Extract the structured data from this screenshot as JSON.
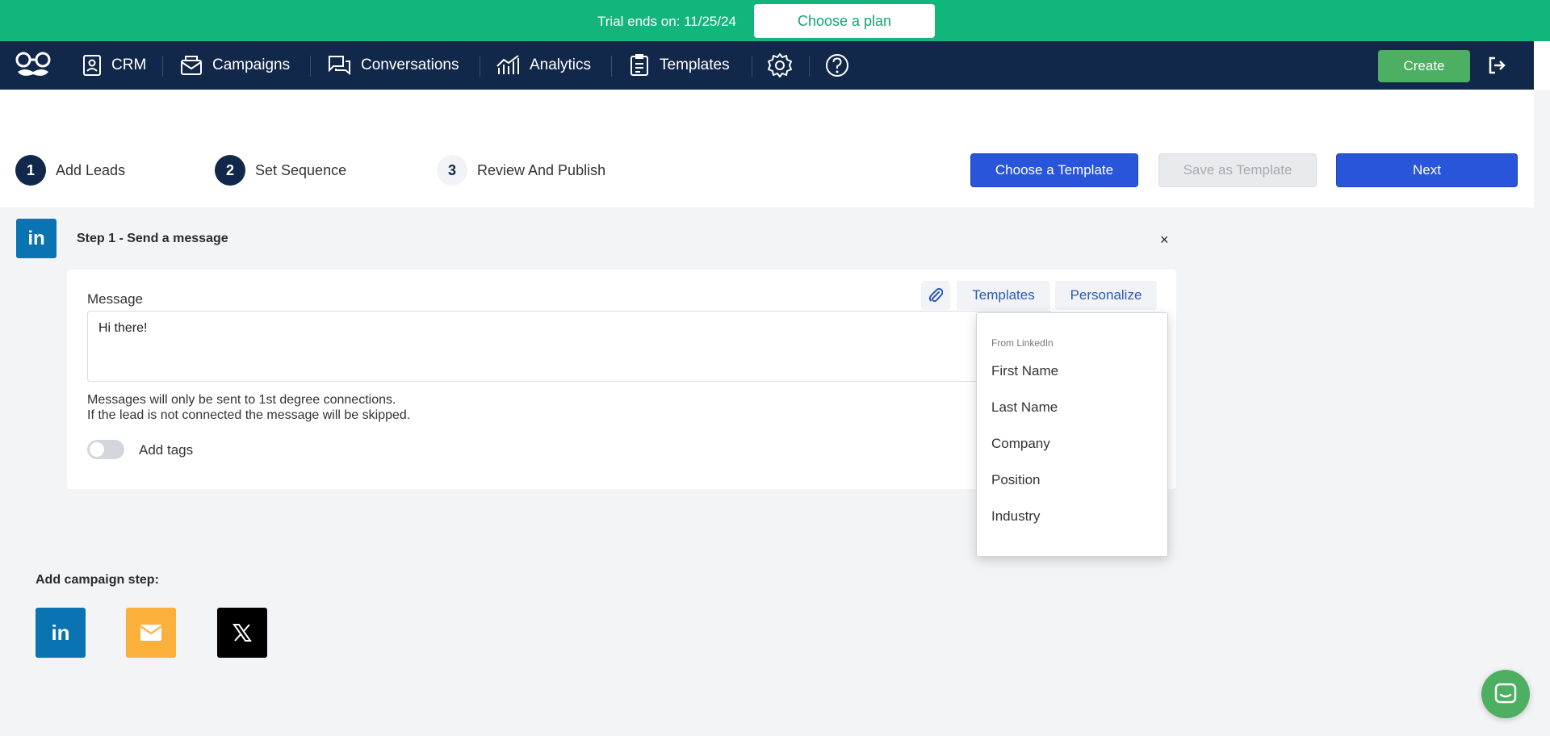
{
  "trial_banner": {
    "text": "Trial ends on: 11/25/24",
    "button_label": "Choose a plan"
  },
  "nav": {
    "items": [
      {
        "label": "CRM",
        "icon": "contact-card-icon"
      },
      {
        "label": "Campaigns",
        "icon": "envelope-icon"
      },
      {
        "label": "Conversations",
        "icon": "chat-bubbles-icon"
      },
      {
        "label": "Analytics",
        "icon": "bar-chart-icon"
      },
      {
        "label": "Templates",
        "icon": "document-icon"
      }
    ],
    "settings_icon": "gear-icon",
    "help_icon": "help-circle-icon",
    "create_label": "Create",
    "logout_icon": "logout-icon"
  },
  "stepper": {
    "steps": [
      {
        "number": "1",
        "label": "Add Leads"
      },
      {
        "number": "2",
        "label": "Set Sequence"
      },
      {
        "number": "3",
        "label": "Review And Publish"
      }
    ],
    "choose_template_label": "Choose a Template",
    "save_template_label": "Save as Template",
    "next_label": "Next"
  },
  "step_card": {
    "badge": "in",
    "title": "Step 1 - Send a message",
    "close_label": "×",
    "message_label": "Message",
    "templates_tab": "Templates",
    "personalize_tab": "Personalize",
    "message_value": "Hi there!",
    "hint_line1": "Messages will only be sent to 1st degree connections.",
    "hint_line2": "If the lead is not connected the message will be skipped.",
    "add_tags_label": "Add tags"
  },
  "personalize_dropdown": {
    "section": "From LinkedIn",
    "items": [
      "First Name",
      "Last Name",
      "Company",
      "Position",
      "Industry"
    ]
  },
  "add_step": {
    "title": "Add campaign step:",
    "linkedin_label": "in"
  },
  "colors": {
    "trial_green": "#12b67a",
    "nav_navy": "#12284a",
    "primary_blue": "#2855d9",
    "linkedin_blue": "#0a73b1",
    "email_yellow": "#fbb03b",
    "x_black": "#000000",
    "create_green": "#4caf61"
  }
}
